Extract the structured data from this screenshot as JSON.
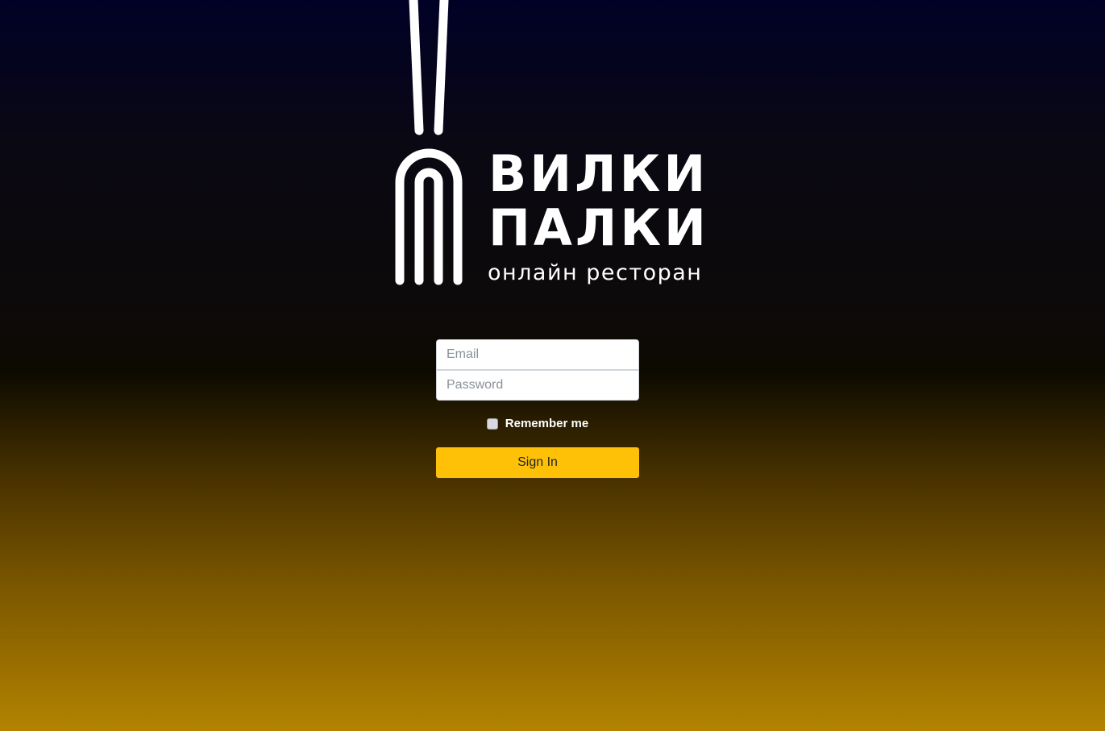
{
  "logo": {
    "line1": "ВИЛКИ",
    "line2": "ПАЛКИ",
    "subtitle": "онлайн ресторан",
    "icon": "fork-chopsticks-icon",
    "color": "#ffffff"
  },
  "login_form": {
    "email_placeholder": "Email",
    "email_value": "",
    "password_placeholder": "Password",
    "password_value": "",
    "remember_label": "Remember me",
    "remember_checked": false,
    "signin_label": "Sign In"
  },
  "colors": {
    "accent": "#ffc107",
    "background_top": "#010127",
    "background_bottom": "#b38300"
  }
}
